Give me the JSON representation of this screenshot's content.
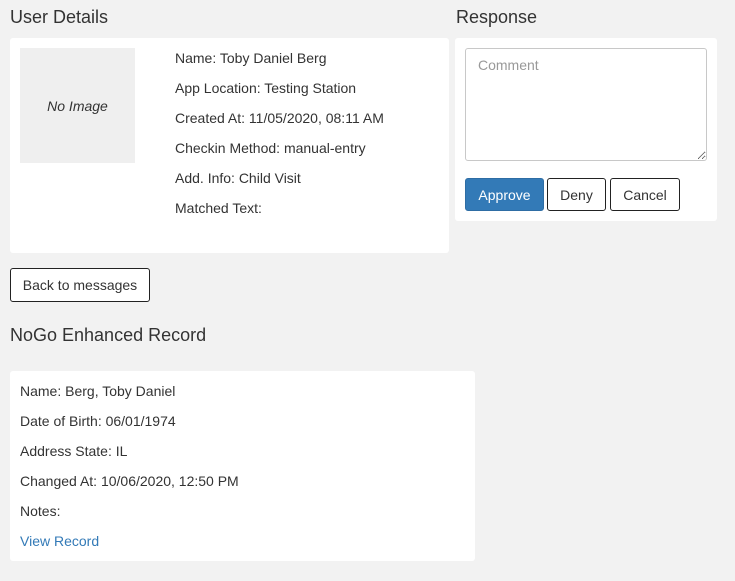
{
  "user_details": {
    "heading": "User Details",
    "image_placeholder": "No Image",
    "fields": [
      "Name: Toby Daniel Berg",
      "App Location: Testing Station",
      "Created At: 11/05/2020, 08:11 AM",
      "Checkin Method: manual-entry",
      "Add. Info: Child Visit",
      "Matched Text:"
    ]
  },
  "response": {
    "heading": "Response",
    "comment_placeholder": "Comment",
    "comment_value": "",
    "approve_label": "Approve",
    "deny_label": "Deny",
    "cancel_label": "Cancel"
  },
  "navigation": {
    "back_label": "Back to messages"
  },
  "nogo_record": {
    "heading": "NoGo Enhanced Record",
    "fields": [
      "Name: Berg, Toby Daniel",
      "Date of Birth: 06/01/1974",
      "Address State: IL",
      "Changed At: 10/06/2020, 12:50 PM",
      "Notes:"
    ],
    "view_link_label": "View Record"
  },
  "colors": {
    "background": "#f2f2f2",
    "panel": "#ffffff",
    "primary": "#337ab7"
  }
}
